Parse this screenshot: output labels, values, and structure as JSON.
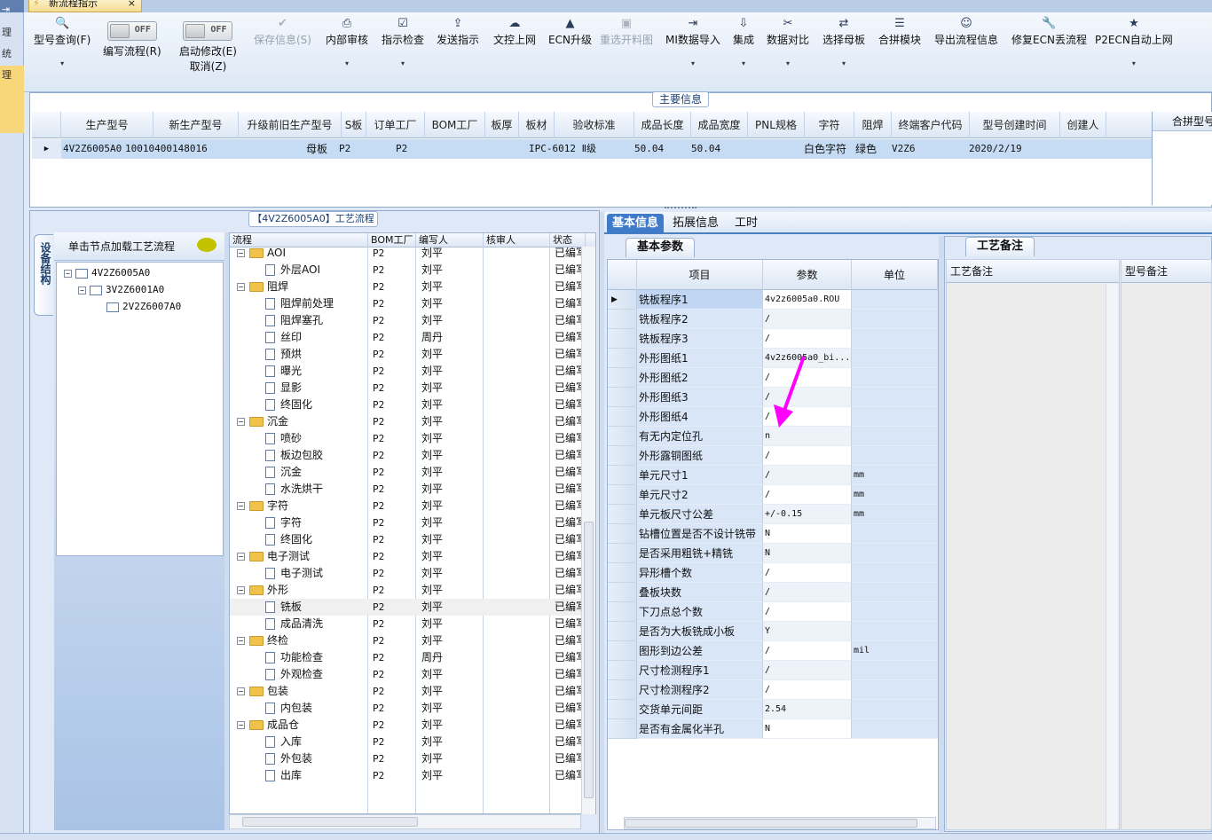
{
  "app": {
    "tab_title": "新流程指示",
    "tab_close": "×"
  },
  "left_strip": {
    "items": [
      "理",
      "统",
      "理"
    ]
  },
  "toolbar": {
    "buttons": [
      {
        "label": "型号查询(F)",
        "icon": "search-icon",
        "icon_glyph": "🔍",
        "dropdown": true,
        "enabled": true
      },
      {
        "label": "编写流程(R)",
        "toggle": "OFF",
        "enabled": true
      },
      {
        "label": "启动修改(E)",
        "label2": "取消(Z)",
        "toggle": "OFF",
        "enabled": true
      },
      {
        "label": "保存信息(S)",
        "icon": "check-icon",
        "icon_glyph": "✔",
        "enabled": false
      },
      {
        "label": "内部审核",
        "icon": "print-icon",
        "icon_glyph": "⎙",
        "dropdown": true,
        "enabled": true
      },
      {
        "label": "指示检查",
        "icon": "checkbox-icon",
        "icon_glyph": "☑",
        "dropdown": true,
        "enabled": true
      },
      {
        "label": "发送指示",
        "icon": "upload-icon",
        "icon_glyph": "⇪",
        "enabled": true
      },
      {
        "label": "文控上网",
        "icon": "cloud-upload-icon",
        "icon_glyph": "☁",
        "enabled": true
      },
      {
        "label": "ECN升级",
        "icon": "ecn-icon",
        "icon_glyph": "▲",
        "enabled": true
      },
      {
        "label": "重选开料图",
        "icon": "image-icon",
        "icon_glyph": "▣",
        "enabled": false
      },
      {
        "label": "MI数据导入",
        "icon": "import-icon",
        "icon_glyph": "⇥",
        "dropdown": true,
        "enabled": true
      },
      {
        "label": "集成",
        "icon": "download-icon",
        "icon_glyph": "⇩",
        "dropdown": true,
        "enabled": true
      },
      {
        "label": "数据对比",
        "icon": "compare-icon",
        "icon_glyph": "✂",
        "dropdown": true,
        "enabled": true
      },
      {
        "label": "选择母板",
        "icon": "shuffle-icon",
        "icon_glyph": "⇄",
        "dropdown": true,
        "enabled": true
      },
      {
        "label": "合拼模块",
        "icon": "list-icon",
        "icon_glyph": "☰",
        "enabled": true
      },
      {
        "label": "导出流程信息",
        "icon": "smile-icon",
        "icon_glyph": "☺",
        "enabled": true
      },
      {
        "label": "修复ECN丢流程",
        "icon": "wrench-icon",
        "icon_glyph": "🔧",
        "enabled": true
      },
      {
        "label": "P2ECN自动上网",
        "icon": "star-icon",
        "icon_glyph": "★",
        "dropdown": true,
        "enabled": true
      }
    ]
  },
  "main_info": {
    "title": "主要信息",
    "columns": [
      "生产型号",
      "新生产型号",
      "升级前旧生产型号",
      "S板",
      "订单工厂",
      "BOM工厂",
      "板厚",
      "板材",
      "验收标准",
      "成品长度",
      "成品宽度",
      "PNL规格",
      "字符",
      "阻焊",
      "终端客户代码",
      "型号创建时间",
      "创建人"
    ],
    "row": [
      "4V2Z6005A0",
      "10010400148016",
      "",
      "母板",
      "P2",
      "P2",
      "",
      "",
      "IPC-6012 Ⅱ级",
      "50.04",
      "50.04",
      "",
      "白色字符",
      "绿色",
      "V2Z6",
      "2020/2/19",
      ""
    ],
    "merge_header": "合拼型号"
  },
  "flow": {
    "title": "【4V2Z6005A0】工艺流程",
    "vtab_label": "设备结构",
    "tree_header": "单击节点加载工艺流程",
    "tree": [
      {
        "label": "4V2Z6005A0"
      },
      {
        "label": "3V2Z6001A0"
      },
      {
        "label": "2V2Z6007A0"
      }
    ],
    "columns": [
      "流程",
      "BOM工厂",
      "编写人",
      "核审人",
      "状态"
    ],
    "rows": [
      {
        "name": "AOI",
        "type": "folder",
        "factory": "P2",
        "writer": "刘平",
        "status": "已编写"
      },
      {
        "name": "外层AOI",
        "type": "doc",
        "factory": "P2",
        "writer": "刘平",
        "status": "已编写"
      },
      {
        "name": "阻焊",
        "type": "folder",
        "factory": "P2",
        "writer": "刘平",
        "status": "已编写"
      },
      {
        "name": "阻焊前处理",
        "type": "doc",
        "factory": "P2",
        "writer": "刘平",
        "status": "已编写"
      },
      {
        "name": "阻焊塞孔",
        "type": "doc",
        "factory": "P2",
        "writer": "刘平",
        "status": "已编写"
      },
      {
        "name": "丝印",
        "type": "doc",
        "factory": "P2",
        "writer": "周丹",
        "status": "已编写"
      },
      {
        "name": "预烘",
        "type": "doc",
        "factory": "P2",
        "writer": "刘平",
        "status": "已编写"
      },
      {
        "name": "曝光",
        "type": "doc",
        "factory": "P2",
        "writer": "刘平",
        "status": "已编写"
      },
      {
        "name": "显影",
        "type": "doc",
        "factory": "P2",
        "writer": "刘平",
        "status": "已编写"
      },
      {
        "name": "终固化",
        "type": "doc",
        "factory": "P2",
        "writer": "刘平",
        "status": "已编写"
      },
      {
        "name": "沉金",
        "type": "folder",
        "factory": "P2",
        "writer": "刘平",
        "status": "已编写"
      },
      {
        "name": "喷砂",
        "type": "doc",
        "factory": "P2",
        "writer": "刘平",
        "status": "已编写"
      },
      {
        "name": "板边包胶",
        "type": "doc",
        "factory": "P2",
        "writer": "刘平",
        "status": "已编写"
      },
      {
        "name": "沉金",
        "type": "doc",
        "factory": "P2",
        "writer": "刘平",
        "status": "已编写"
      },
      {
        "name": "水洗烘干",
        "type": "doc",
        "factory": "P2",
        "writer": "刘平",
        "status": "已编写"
      },
      {
        "name": "字符",
        "type": "folder",
        "factory": "P2",
        "writer": "刘平",
        "status": "已编写"
      },
      {
        "name": "字符",
        "type": "doc",
        "factory": "P2",
        "writer": "刘平",
        "status": "已编写"
      },
      {
        "name": "终固化",
        "type": "doc",
        "factory": "P2",
        "writer": "刘平",
        "status": "已编写"
      },
      {
        "name": "电子测试",
        "type": "folder",
        "factory": "P2",
        "writer": "刘平",
        "status": "已编写"
      },
      {
        "name": "电子测试",
        "type": "doc",
        "factory": "P2",
        "writer": "刘平",
        "status": "已编写"
      },
      {
        "name": "外形",
        "type": "folder",
        "factory": "P2",
        "writer": "刘平",
        "status": "已编写"
      },
      {
        "name": "铣板",
        "type": "doc",
        "factory": "P2",
        "writer": "刘平",
        "status": "已编写",
        "selected": true
      },
      {
        "name": "成品清洗",
        "type": "doc",
        "factory": "P2",
        "writer": "刘平",
        "status": "已编写"
      },
      {
        "name": "终检",
        "type": "folder",
        "factory": "P2",
        "writer": "刘平",
        "status": "已编写"
      },
      {
        "name": "功能检查",
        "type": "doc",
        "factory": "P2",
        "writer": "周丹",
        "status": "已编写"
      },
      {
        "name": "外观检查",
        "type": "doc",
        "factory": "P2",
        "writer": "刘平",
        "status": "已编写"
      },
      {
        "name": "包装",
        "type": "folder",
        "factory": "P2",
        "writer": "刘平",
        "status": "已编写"
      },
      {
        "name": "内包装",
        "type": "doc",
        "factory": "P2",
        "writer": "刘平",
        "status": "已编写"
      },
      {
        "name": "成品仓",
        "type": "folder",
        "factory": "P2",
        "writer": "刘平",
        "status": "已编写"
      },
      {
        "name": "入库",
        "type": "doc",
        "factory": "P2",
        "writer": "刘平",
        "status": "已编写"
      },
      {
        "name": "外包装",
        "type": "doc",
        "factory": "P2",
        "writer": "刘平",
        "status": "已编写"
      },
      {
        "name": "出库",
        "type": "doc",
        "factory": "P2",
        "writer": "刘平",
        "status": "已编写"
      }
    ]
  },
  "detail": {
    "tabs": [
      "基本信息",
      "拓展信息",
      "工时"
    ],
    "active_tab": "基本信息",
    "subtab": "基本参数",
    "columns": [
      "项目",
      "参数",
      "单位"
    ],
    "rows": [
      {
        "item": "铣板程序1",
        "value": "4v2z6005a0.ROU",
        "unit": ""
      },
      {
        "item": "铣板程序2",
        "value": "/",
        "unit": ""
      },
      {
        "item": "铣板程序3",
        "value": "/",
        "unit": ""
      },
      {
        "item": "外形图纸1",
        "value": "4v2z6005a0_bi...",
        "unit": ""
      },
      {
        "item": "外形图纸2",
        "value": "/",
        "unit": ""
      },
      {
        "item": "外形图纸3",
        "value": "/",
        "unit": ""
      },
      {
        "item": "外形图纸4",
        "value": "/",
        "unit": ""
      },
      {
        "item": "有无内定位孔",
        "value": "n",
        "unit": ""
      },
      {
        "item": "外形露铜图纸",
        "value": "/",
        "unit": ""
      },
      {
        "item": "单元尺寸1",
        "value": "/",
        "unit": "mm"
      },
      {
        "item": "单元尺寸2",
        "value": "/",
        "unit": "mm"
      },
      {
        "item": "单元板尺寸公差",
        "value": "+/-0.15",
        "unit": "mm"
      },
      {
        "item": "钻槽位置是否不设计铣带",
        "value": "N",
        "unit": ""
      },
      {
        "item": "是否采用粗铣+精铣",
        "value": "N",
        "unit": ""
      },
      {
        "item": "异形槽个数",
        "value": "/",
        "unit": ""
      },
      {
        "item": "叠板块数",
        "value": "/",
        "unit": ""
      },
      {
        "item": "下刀点总个数",
        "value": "/",
        "unit": ""
      },
      {
        "item": "是否为大板铣成小板",
        "value": "Y",
        "unit": ""
      },
      {
        "item": "图形到边公差",
        "value": "/",
        "unit": "mil"
      },
      {
        "item": "尺寸检测程序1",
        "value": "/",
        "unit": ""
      },
      {
        "item": "尺寸检测程序2",
        "value": "/",
        "unit": ""
      },
      {
        "item": "交货单元间距",
        "value": "2.54",
        "unit": ""
      },
      {
        "item": "是否有金属化半孔",
        "value": "N",
        "unit": ""
      }
    ]
  },
  "notes": {
    "tab": "工艺备注",
    "col1": "工艺备注",
    "col2": "型号备注"
  },
  "annotation": {
    "arrow_color": "#ff00ff"
  }
}
